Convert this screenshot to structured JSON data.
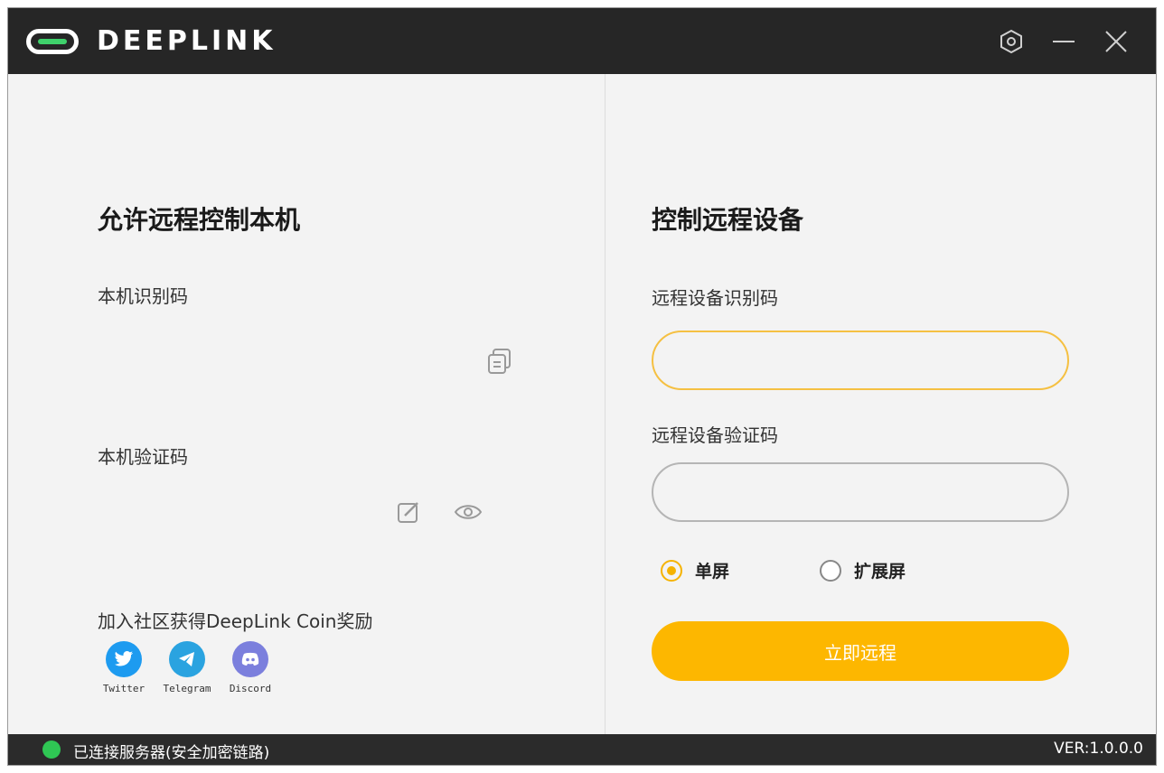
{
  "app": {
    "brand_name": "DEEPLINK",
    "brand_accent": "#3fd16b"
  },
  "titlebar": {
    "controls": [
      {
        "name": "settings",
        "icon": "hexagon-gear-icon"
      },
      {
        "name": "minimize",
        "icon": "minus-icon"
      },
      {
        "name": "close",
        "icon": "close-icon"
      }
    ]
  },
  "left_panel": {
    "title": "允许远程控制本机",
    "device_id_label": "本机识别码",
    "device_id_value": "",
    "copy_icon": "copy-icon",
    "verify_code_label": "本机验证码",
    "verify_code_value": "",
    "edit_icon": "edit-icon",
    "view_icon": "eye-icon",
    "community_text": "加入社区获得DeepLink Coin奖励",
    "socials": [
      {
        "label": "Twitter",
        "icon": "twitter-icon",
        "color": "#1d9bf0"
      },
      {
        "label": "Telegram",
        "icon": "telegram-icon",
        "color": "#2aa3e0"
      },
      {
        "label": "Discord",
        "icon": "discord-icon",
        "color": "#7b7fdd"
      }
    ]
  },
  "right_panel": {
    "title": "控制远程设备",
    "remote_id_label": "远程设备识别码",
    "remote_id_value": "",
    "remote_code_label": "远程设备验证码",
    "remote_code_value": "",
    "display_options": [
      {
        "label": "单屏",
        "selected": true
      },
      {
        "label": "扩展屏",
        "selected": false
      }
    ],
    "connect_button": "立即远程",
    "accent": "#fdb700"
  },
  "statusbar": {
    "status_text": "已连接服务器(安全加密链路)",
    "status_color": "#2fc654",
    "version": "VER:1.0.0.0"
  }
}
